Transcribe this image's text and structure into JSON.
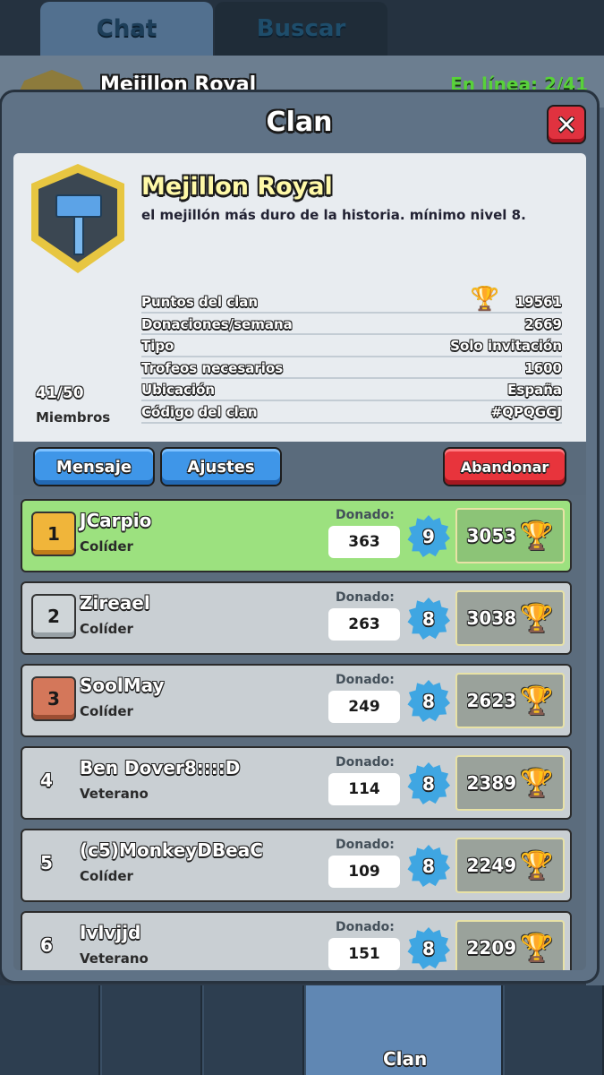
{
  "background": {
    "tabs": [
      {
        "label": "Chat"
      },
      {
        "label": "Buscar"
      }
    ],
    "clan_name": "Mejillon Royal",
    "online_status": "En línea: 2/41"
  },
  "panel": {
    "title": "Clan",
    "close_icon": "close-icon"
  },
  "clan": {
    "name": "Mejillon Royal",
    "description": "el mejillón más duro de la historia. mínimo nivel 8.",
    "members_count": "41/50",
    "members_label": "Miembros",
    "stats": [
      {
        "label": "Puntos del clan",
        "value": "19561",
        "icon": "trophy-icon"
      },
      {
        "label": "Donaciones/semana",
        "value": "2669"
      },
      {
        "label": "Tipo",
        "value": "Solo invitación"
      },
      {
        "label": "Trofeos necesarios",
        "value": "1600"
      },
      {
        "label": "Ubicación",
        "value": "España"
      },
      {
        "label": "Código del clan",
        "value": "#QPQGGJ"
      }
    ]
  },
  "actions": {
    "message_label": "Mensaje",
    "settings_label": "Ajustes",
    "leave_label": "Abandonar"
  },
  "members": [
    {
      "rank": "1",
      "name": "JCarpio",
      "role": "Colíder",
      "donated_label": "Donado:",
      "donated": "363",
      "level": "9",
      "trophies": "3053"
    },
    {
      "rank": "2",
      "name": "Zireael",
      "role": "Colíder",
      "donated_label": "Donado:",
      "donated": "263",
      "level": "8",
      "trophies": "3038"
    },
    {
      "rank": "3",
      "name": "SoolMay",
      "role": "Colíder",
      "donated_label": "Donado:",
      "donated": "249",
      "level": "8",
      "trophies": "2623"
    },
    {
      "rank": "4",
      "name": "Ben Dover8::::D",
      "role": "Veterano",
      "donated_label": "Donado:",
      "donated": "114",
      "level": "8",
      "trophies": "2389"
    },
    {
      "rank": "5",
      "name": "(c5)MonkeyDBeaC",
      "role": "Colíder",
      "donated_label": "Donado:",
      "donated": "109",
      "level": "8",
      "trophies": "2249"
    },
    {
      "rank": "6",
      "name": "Ivlvjjd",
      "role": "Veterano",
      "donated_label": "Donado:",
      "donated": "151",
      "level": "8",
      "trophies": "2209"
    }
  ],
  "bottom_nav": {
    "active_label": "Clan"
  },
  "colors": {
    "panel": "#5f7286",
    "accent_blue": "#3f96e8",
    "accent_red": "#e8343c",
    "first_row": "#9ce17f"
  }
}
